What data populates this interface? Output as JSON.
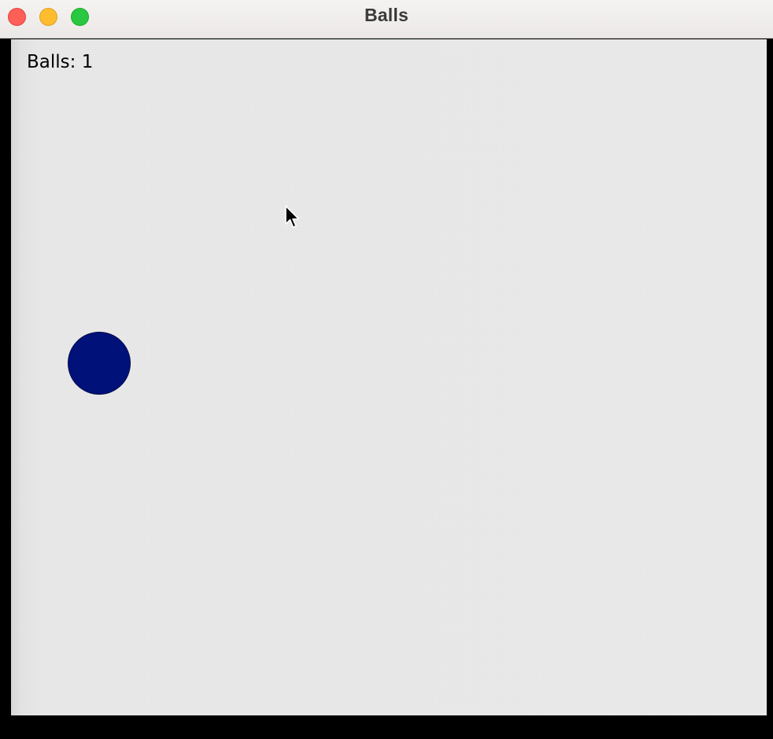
{
  "window": {
    "title": "Balls"
  },
  "window_controls": {
    "close_color": "#fe5f57",
    "minimize_color": "#febc2e",
    "zoom_color": "#28c840"
  },
  "game": {
    "ball_counter_label": "Balls: 1",
    "ball_count": 1,
    "ball_color": "#00117a",
    "background_color": "#e9e9e9"
  },
  "cursor": {
    "icon": "arrow-pointer-icon"
  }
}
